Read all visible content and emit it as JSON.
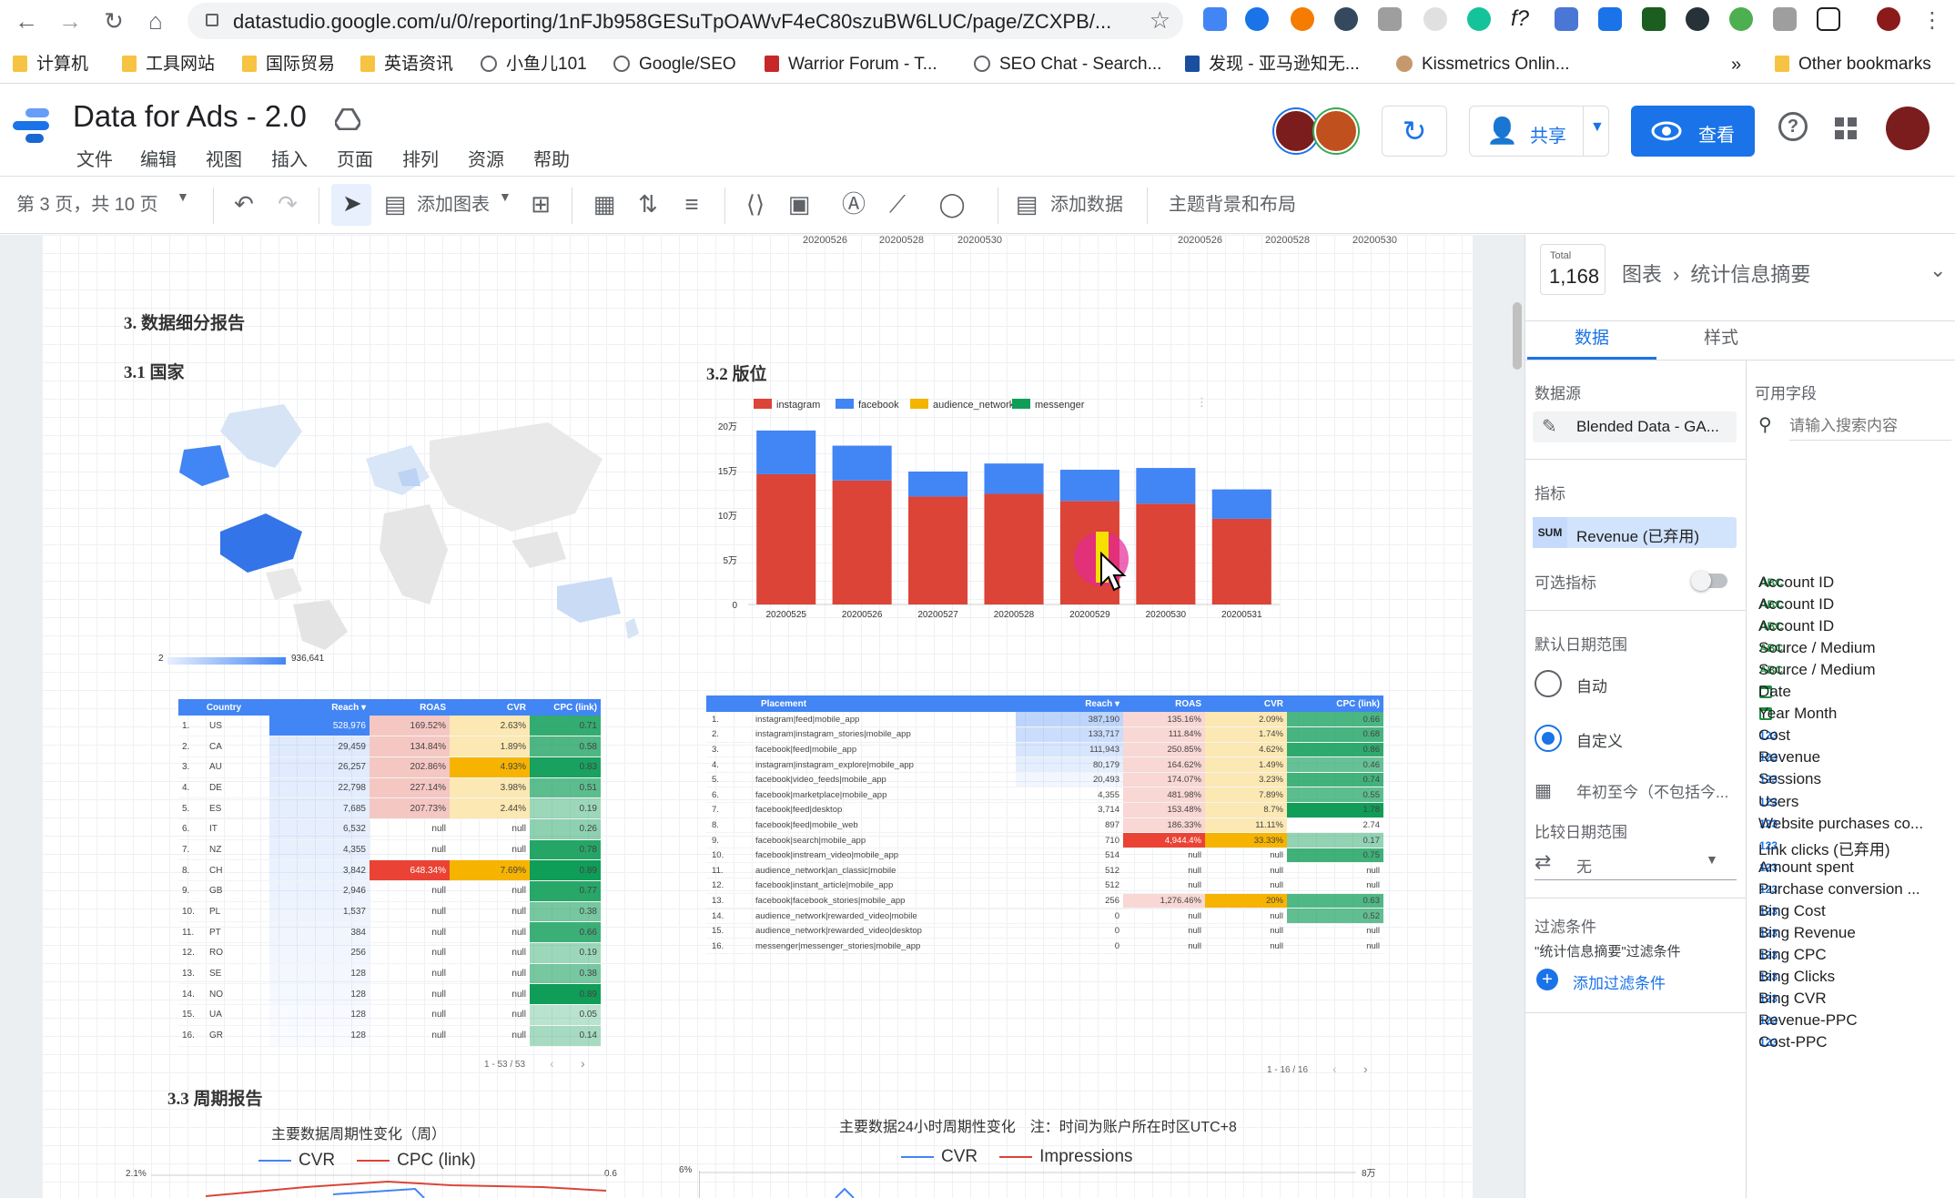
{
  "browser": {
    "url": "datastudio.google.com/u/0/reporting/1nFJb958GESuTpOAWvF4eC80szuBW6LUC/page/ZCXPB/...",
    "bookmarks": [
      "计算机",
      "工具网站",
      "国际贸易",
      "英语资讯",
      "小鱼儿101",
      "Google/SEO",
      "Warrior Forum - T...",
      "SEO Chat - Search...",
      "发现 - 亚马逊知无...",
      "Kissmetrics Onlin..."
    ],
    "bookmarks_more": "»",
    "other_bookmarks": "Other bookmarks"
  },
  "app": {
    "title": "Data for Ads - 2.0",
    "menu": [
      "文件",
      "编辑",
      "视图",
      "插入",
      "页面",
      "排列",
      "资源",
      "帮助"
    ],
    "share_label": "共享",
    "view_label": "查看"
  },
  "toolbar": {
    "page_indicator": "第 3 页，共 10 页",
    "add_chart": "添加图表",
    "add_data": "添加数据",
    "theme_layout": "主题背景和布局"
  },
  "report": {
    "top_labels_left": [
      "20200526",
      "20200528",
      "20200530"
    ],
    "top_labels_right": [
      "20200526",
      "20200528",
      "20200530"
    ],
    "section_title": "3. 数据细分报告",
    "country_title": "3.1 国家",
    "placement_title": "3.2 版位",
    "map_legend_min": "2",
    "map_legend_max": "936,641",
    "cycle_title": "3.3 周期报告",
    "weekly_title": "主要数据周期性变化（周）",
    "hourly_title": "主要数据24小时周期性变化　注：时间为账户所在时区UTC+8",
    "weekly_legend": [
      "CVR",
      "CPC (link)"
    ],
    "hourly_legend": [
      "CVR",
      "Impressions"
    ],
    "weekly_y_left": "2.1%",
    "weekly_y_right": "0.6",
    "hourly_y_left": "6%",
    "hourly_y_right": "8万"
  },
  "country_table": {
    "headers": [
      "Country",
      "Reach ▾",
      "ROAS",
      "CVR",
      "CPC (link)"
    ],
    "rows": [
      [
        "1.",
        "US",
        "528,976",
        "169.52%",
        "2.63%",
        "0.71"
      ],
      [
        "2.",
        "CA",
        "29,459",
        "134.84%",
        "1.89%",
        "0.58"
      ],
      [
        "3.",
        "AU",
        "26,257",
        "202.86%",
        "4.93%",
        "0.83"
      ],
      [
        "4.",
        "DE",
        "22,798",
        "227.14%",
        "3.98%",
        "0.51"
      ],
      [
        "5.",
        "ES",
        "7,685",
        "207.73%",
        "2.44%",
        "0.19"
      ],
      [
        "6.",
        "IT",
        "6,532",
        "null",
        "null",
        "0.26"
      ],
      [
        "7.",
        "NZ",
        "4,355",
        "null",
        "null",
        "0.78"
      ],
      [
        "8.",
        "CH",
        "3,842",
        "648.34%",
        "7.69%",
        "0.89"
      ],
      [
        "9.",
        "GB",
        "2,946",
        "null",
        "null",
        "0.77"
      ],
      [
        "10.",
        "PL",
        "1,537",
        "null",
        "null",
        "0.38"
      ],
      [
        "11.",
        "PT",
        "384",
        "null",
        "null",
        "0.66"
      ],
      [
        "12.",
        "RO",
        "256",
        "null",
        "null",
        "0.19"
      ],
      [
        "13.",
        "SE",
        "128",
        "null",
        "null",
        "0.38"
      ],
      [
        "14.",
        "NO",
        "128",
        "null",
        "null",
        "0.89"
      ],
      [
        "15.",
        "UA",
        "128",
        "null",
        "null",
        "0.05"
      ],
      [
        "16.",
        "GR",
        "128",
        "null",
        "null",
        "0.14"
      ]
    ],
    "pagination": "1 - 53 / 53"
  },
  "placement_table": {
    "headers": [
      "Placement",
      "Reach ▾",
      "ROAS",
      "CVR",
      "CPC (link)"
    ],
    "rows": [
      [
        "1.",
        "instagram|feed|mobile_app",
        "387,190",
        "135.16%",
        "2.09%",
        "0.66"
      ],
      [
        "2.",
        "instagram|instagram_stories|mobile_app",
        "133,717",
        "111.84%",
        "1.74%",
        "0.68"
      ],
      [
        "3.",
        "facebook|feed|mobile_app",
        "111,943",
        "250.85%",
        "4.62%",
        "0.86"
      ],
      [
        "4.",
        "instagram|instagram_explore|mobile_app",
        "80,179",
        "164.62%",
        "1.49%",
        "0.46"
      ],
      [
        "5.",
        "facebook|video_feeds|mobile_app",
        "20,493",
        "174.07%",
        "3.23%",
        "0.74"
      ],
      [
        "6.",
        "facebook|marketplace|mobile_app",
        "4,355",
        "481.98%",
        "7.89%",
        "0.55"
      ],
      [
        "7.",
        "facebook|feed|desktop",
        "3,714",
        "153.48%",
        "8.7%",
        "1.78"
      ],
      [
        "8.",
        "facebook|feed|mobile_web",
        "897",
        "186.33%",
        "11.11%",
        "2.74"
      ],
      [
        "9.",
        "facebook|search|mobile_app",
        "710",
        "4,944.4%",
        "33.33%",
        "0.17"
      ],
      [
        "10.",
        "facebook|instream_video|mobile_app",
        "514",
        "null",
        "null",
        "0.75"
      ],
      [
        "11.",
        "audience_network|an_classic|mobile",
        "512",
        "null",
        "null",
        "null"
      ],
      [
        "12.",
        "facebook|instant_article|mobile_app",
        "512",
        "null",
        "null",
        "null"
      ],
      [
        "13.",
        "facebook|facebook_stories|mobile_app",
        "256",
        "1,276.46%",
        "20%",
        "0.63"
      ],
      [
        "14.",
        "audience_network|rewarded_video|mobile",
        "0",
        "null",
        "null",
        "0.52"
      ],
      [
        "15.",
        "audience_network|rewarded_video|desktop",
        "0",
        "null",
        "null",
        "null"
      ],
      [
        "16.",
        "messenger|messenger_stories|mobile_app",
        "0",
        "null",
        "null",
        "null"
      ]
    ],
    "pagination": "1 - 16 / 16"
  },
  "chart_data": {
    "type": "bar",
    "title": "",
    "categories": [
      "20200525",
      "20200526",
      "20200527",
      "20200528",
      "20200529",
      "20200530",
      "20200531"
    ],
    "series": [
      {
        "name": "instagram",
        "color": "#db4437",
        "values": [
          146000,
          139000,
          121000,
          124000,
          116000,
          113000,
          96000
        ]
      },
      {
        "name": "facebook",
        "color": "#4285f4",
        "values": [
          49000,
          39000,
          28000,
          34000,
          35000,
          40000,
          33000
        ]
      },
      {
        "name": "audience_network",
        "color": "#f4b400",
        "values": [
          0,
          0,
          0,
          0,
          0,
          0,
          0
        ]
      },
      {
        "name": "messenger",
        "color": "#0f9d58",
        "values": [
          0,
          0,
          0,
          0,
          0,
          0,
          0
        ]
      }
    ],
    "stacked": true,
    "ylim": [
      0,
      200000
    ],
    "yticks": [
      "0",
      "5万",
      "10万",
      "15万",
      "20万"
    ],
    "legend_position": "top-left",
    "grid": false
  },
  "panel": {
    "total_label": "Total",
    "total_value": "1,168",
    "breadcrumb_chart": "图表",
    "breadcrumb_item": "统计信息摘要",
    "tab_data": "数据",
    "tab_style": "样式",
    "datasource_label": "数据源",
    "datasource_value": "Blended Data - GA...",
    "metric_label": "指标",
    "metric_agg": "SUM",
    "metric_value": "Revenue (已弃用)",
    "optional_metric_label": "可选指标",
    "date_range_label": "默认日期范围",
    "auto_label": "自动",
    "custom_label": "自定义",
    "custom_range_value": "年初至今（不包括今...",
    "compare_label": "比较日期范围",
    "compare_value": "无",
    "filter_label": "过滤条件",
    "filter_desc": "\"统计信息摘要\"过滤条件",
    "add_filter": "添加过滤条件",
    "fields_label": "可用字段",
    "search_placeholder": "请输入搜索内容",
    "fields": [
      {
        "type": "ABC",
        "name": "Account ID"
      },
      {
        "type": "ABC",
        "name": "Account ID"
      },
      {
        "type": "ABC",
        "name": "Account ID"
      },
      {
        "type": "ABC",
        "name": "Source / Medium"
      },
      {
        "type": "ABC",
        "name": "Source / Medium"
      },
      {
        "type": "cal",
        "name": "Date"
      },
      {
        "type": "cal",
        "name": "Year Month"
      },
      {
        "type": "123",
        "name": "Cost"
      },
      {
        "type": "123",
        "name": "Revenue"
      },
      {
        "type": "123",
        "name": "Sessions"
      },
      {
        "type": "123",
        "name": "Users"
      },
      {
        "type": "123",
        "name": "Website purchases co..."
      },
      {
        "type": "123",
        "name": "Link clicks (已弃用)"
      },
      {
        "type": "123",
        "name": "Amount spent"
      },
      {
        "type": "123",
        "name": "Purchase conversion ..."
      },
      {
        "type": "123",
        "name": "Bing Cost"
      },
      {
        "type": "123",
        "name": "Bing Revenue"
      },
      {
        "type": "123",
        "name": "Bing CPC"
      },
      {
        "type": "123",
        "name": "Bing Clicks"
      },
      {
        "type": "123",
        "name": "Bing CVR"
      },
      {
        "type": "123",
        "name": "Revenue-PPC"
      },
      {
        "type": "123",
        "name": "Cost-PPC"
      }
    ]
  }
}
